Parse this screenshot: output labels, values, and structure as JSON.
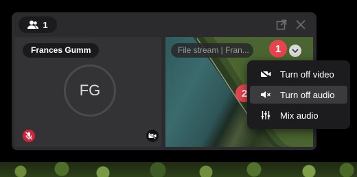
{
  "participants": {
    "count": "1",
    "icon": "people-icon"
  },
  "window_controls": {
    "popout": "external-link-icon",
    "close": "close-icon"
  },
  "tiles": {
    "local": {
      "name": "Frances Gumm",
      "initials": "FG",
      "mic_status": "muted",
      "camera_status": "off"
    },
    "stream": {
      "label": "File stream | Fran..."
    }
  },
  "steps": {
    "one": "1",
    "two": "2"
  },
  "menu": {
    "items": [
      {
        "label": "Turn off video",
        "icon": "video-off-icon"
      },
      {
        "label": "Turn off audio",
        "icon": "speaker-mute-icon"
      },
      {
        "label": "Mix audio",
        "icon": "sliders-icon"
      }
    ]
  },
  "colors": {
    "accent_red": "#e8434e",
    "mic_red": "#d4243a"
  }
}
